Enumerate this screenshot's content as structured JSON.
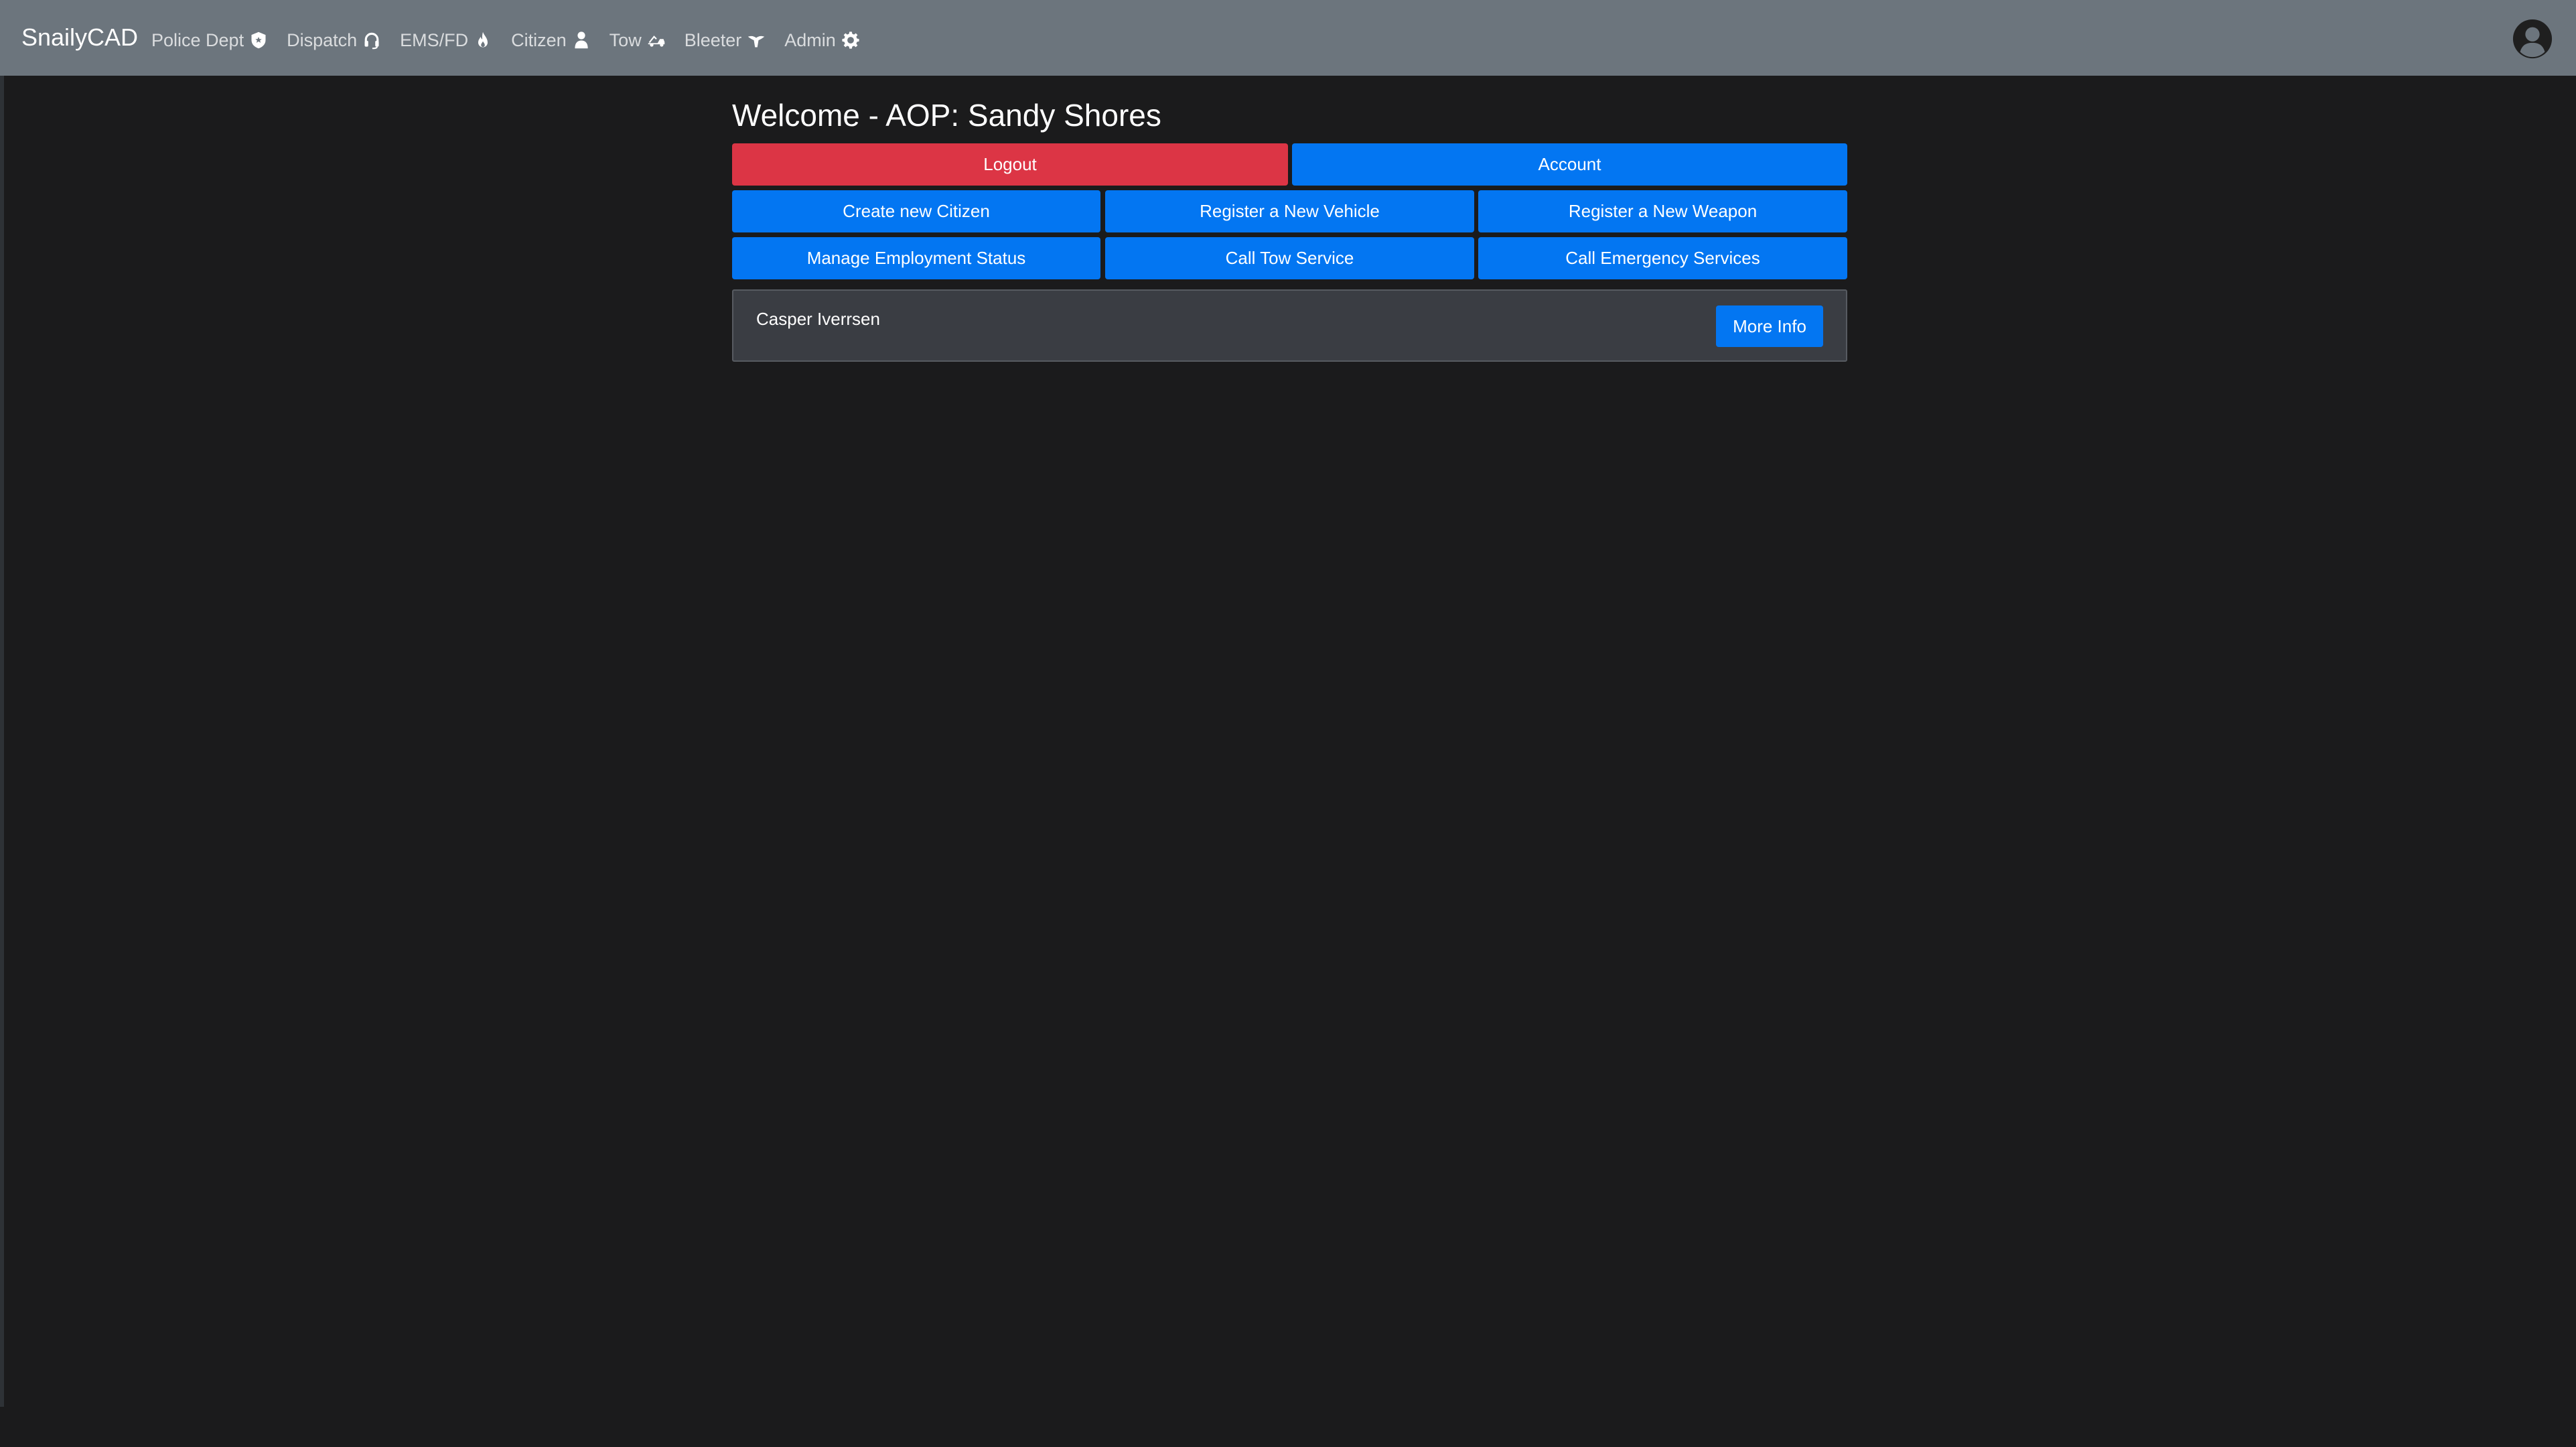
{
  "navbar": {
    "brand": "SnailyCAD",
    "items": [
      {
        "label": "Police Dept",
        "icon": "shield-icon"
      },
      {
        "label": "Dispatch",
        "icon": "headset-icon"
      },
      {
        "label": "EMS/FD",
        "icon": "fire-icon"
      },
      {
        "label": "Citizen",
        "icon": "person-icon"
      },
      {
        "label": "Tow",
        "icon": "tow-truck-icon"
      },
      {
        "label": "Bleeter",
        "icon": "bird-icon"
      },
      {
        "label": "Admin",
        "icon": "gear-icon"
      }
    ],
    "account_icon": "user-circle-icon"
  },
  "main": {
    "title": "Welcome - AOP: Sandy Shores",
    "buttons": {
      "logout": "Logout",
      "account": "Account",
      "create_citizen": "Create new Citizen",
      "register_vehicle": "Register a New Vehicle",
      "register_weapon": "Register a New Weapon",
      "manage_employment": "Manage Employment Status",
      "call_tow": "Call Tow Service",
      "call_emergency": "Call Emergency Services"
    },
    "citizens": [
      {
        "name": "Casper Iverrsen",
        "more_info_label": "More Info"
      }
    ]
  },
  "colors": {
    "navbar_bg": "#6c757d",
    "page_bg": "#1b1b1c",
    "primary": "#0376f2",
    "danger": "#dc3545",
    "card_bg": "#3a3d43"
  }
}
